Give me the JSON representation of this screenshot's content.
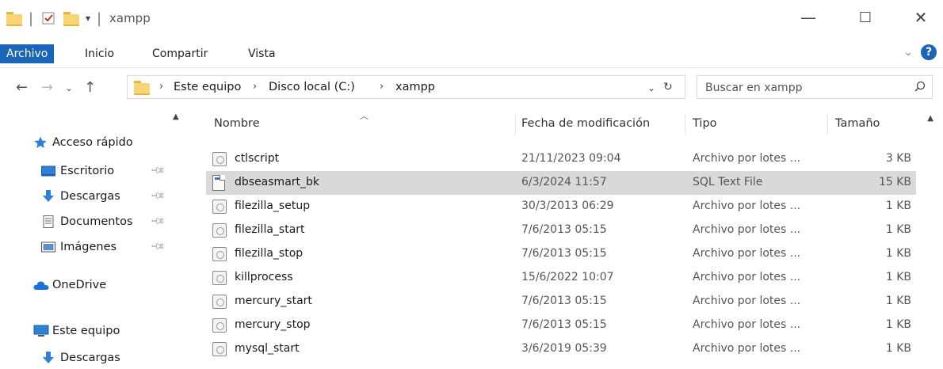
{
  "window": {
    "title": "xampp",
    "minimize": "—",
    "maximize": "☐",
    "close": "✕"
  },
  "ribbon": {
    "tabs": [
      {
        "label": "Archivo",
        "active": true
      },
      {
        "label": "Inicio"
      },
      {
        "label": "Compartir"
      },
      {
        "label": "Vista"
      }
    ],
    "help": "?"
  },
  "address": {
    "crumbs": [
      "Este equipo",
      "Disco local (C:)",
      "xampp"
    ],
    "search_placeholder": "Buscar en xampp"
  },
  "navpane": {
    "items": [
      {
        "label": "Acceso rápido",
        "icon": "star-icon",
        "pinned": false
      },
      {
        "label": "Escritorio",
        "icon": "desktop-icon",
        "pinned": true
      },
      {
        "label": "Descargas",
        "icon": "download-arrow-icon",
        "pinned": true
      },
      {
        "label": "Documentos",
        "icon": "document-icon",
        "pinned": true
      },
      {
        "label": "Imágenes",
        "icon": "image-icon",
        "pinned": true
      },
      {
        "label": "OneDrive",
        "icon": "cloud-icon",
        "pinned": false
      },
      {
        "label": "Este equipo",
        "icon": "computer-icon",
        "pinned": false
      },
      {
        "label": "Descargas",
        "icon": "download-arrow-icon",
        "pinned": false
      }
    ]
  },
  "filelist": {
    "columns": {
      "name": "Nombre",
      "date": "Fecha de modificación",
      "type": "Tipo",
      "size": "Tamaño"
    },
    "rows": [
      {
        "name": "ctlscript",
        "date": "21/11/2023 09:04",
        "type": "Archivo por lotes ...",
        "size": "3 KB",
        "icon": "batch-file-icon"
      },
      {
        "name": "dbseasmart_bk",
        "date": "6/3/2024 11:57",
        "type": "SQL Text File",
        "size": "15 KB",
        "icon": "sql-file-icon",
        "selected": true
      },
      {
        "name": "filezilla_setup",
        "date": "30/3/2013 06:29",
        "type": "Archivo por lotes ...",
        "size": "1 KB",
        "icon": "batch-file-icon"
      },
      {
        "name": "filezilla_start",
        "date": "7/6/2013 05:15",
        "type": "Archivo por lotes ...",
        "size": "1 KB",
        "icon": "batch-file-icon"
      },
      {
        "name": "filezilla_stop",
        "date": "7/6/2013 05:15",
        "type": "Archivo por lotes ...",
        "size": "1 KB",
        "icon": "batch-file-icon"
      },
      {
        "name": "killprocess",
        "date": "15/6/2022 10:07",
        "type": "Archivo por lotes ...",
        "size": "1 KB",
        "icon": "batch-file-icon"
      },
      {
        "name": "mercury_start",
        "date": "7/6/2013 05:15",
        "type": "Archivo por lotes ...",
        "size": "1 KB",
        "icon": "batch-file-icon"
      },
      {
        "name": "mercury_stop",
        "date": "7/6/2013 05:15",
        "type": "Archivo por lotes ...",
        "size": "1 KB",
        "icon": "batch-file-icon"
      },
      {
        "name": "mysql_start",
        "date": "3/6/2019 05:39",
        "type": "Archivo por lotes ...",
        "size": "1 KB",
        "icon": "batch-file-icon"
      }
    ]
  }
}
